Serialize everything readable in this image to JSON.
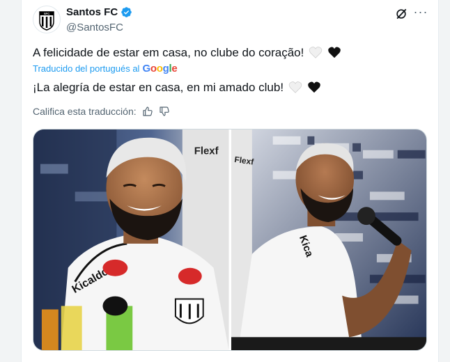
{
  "tweet": {
    "display_name": "Santos FC",
    "handle": "@SantosFC",
    "original_text": "A felicidade de estar em casa, no clube do coração!",
    "translated_label": "Traducido del portugués al",
    "google_label": "Google",
    "translated_text": "¡La alegría de estar en casa, en mi amado club!",
    "rate_label": "Califica esta traducción:",
    "more_label": "···"
  },
  "media": {
    "photo1": {
      "sponsor_text": "Flexf",
      "shirt_text": "Kicaldo"
    },
    "photo2": {
      "sponsor_text": "Flexf",
      "shirt_text": "Kica"
    }
  },
  "colors": {
    "accent": "#1d9bf0",
    "secondary_text": "#536471"
  }
}
